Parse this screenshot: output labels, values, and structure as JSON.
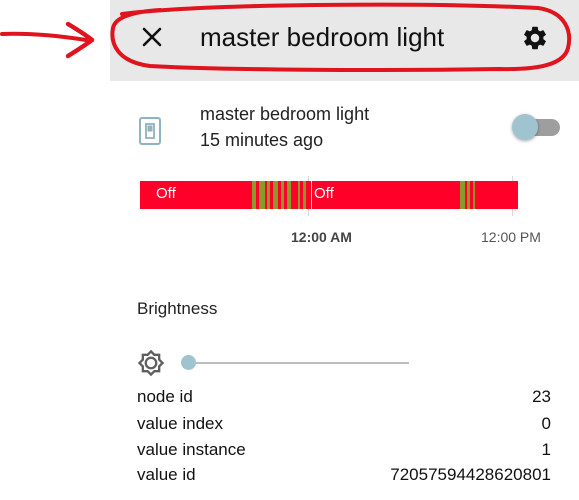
{
  "header": {
    "title": "master bedroom light",
    "close_icon": "close-icon",
    "settings_icon": "gear-icon"
  },
  "entity": {
    "icon": "light-switch-icon",
    "name": "master bedroom light",
    "last_changed": "15 minutes ago",
    "toggle_on": false
  },
  "history": {
    "segments": [
      {
        "label": "Off",
        "state": "off"
      },
      {
        "label": "Off",
        "state": "off"
      }
    ],
    "axis_labels": [
      "12:00 AM",
      "12:00 PM"
    ],
    "colors": {
      "off": "#ff0029",
      "on": "#8a9a2c"
    }
  },
  "brightness": {
    "label": "Brightness",
    "icon": "brightness-icon",
    "value_fraction": 0.0
  },
  "attributes": [
    {
      "key": "node id",
      "value": "23"
    },
    {
      "key": "value index",
      "value": "0"
    },
    {
      "key": "value instance",
      "value": "1"
    },
    {
      "key": "value id",
      "value": "72057594428620801"
    }
  ],
  "colors": {
    "accent": "#9fc4d0",
    "annotation": "#e0141e",
    "header_bg": "#e8e8e8"
  }
}
